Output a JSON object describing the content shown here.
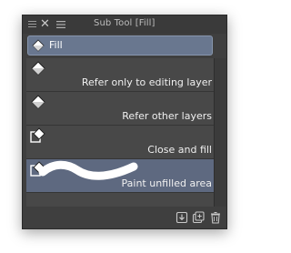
{
  "window": {
    "title": "Sub Tool [Fill]"
  },
  "group": {
    "label": "Fill",
    "icon": "fill-bucket-icon"
  },
  "items": [
    {
      "label": "Refer only to editing layer",
      "icon": "fill-bucket-icon",
      "selected": false
    },
    {
      "label": "Refer other layers",
      "icon": "fill-bucket-icon",
      "selected": false
    },
    {
      "label": "Close and fill",
      "icon": "close-fill-icon",
      "selected": false
    },
    {
      "label": "Paint unfilled area",
      "icon": "paint-unfilled-icon",
      "selected": true
    }
  ],
  "footer": {
    "buttons": [
      "import-icon",
      "duplicate-icon",
      "trash-icon"
    ]
  },
  "colors": {
    "panel_bg": "#3f3f3f",
    "list_bg": "#484848",
    "selected_bg": "#5e6980",
    "group_header_bg": "#69778f"
  }
}
